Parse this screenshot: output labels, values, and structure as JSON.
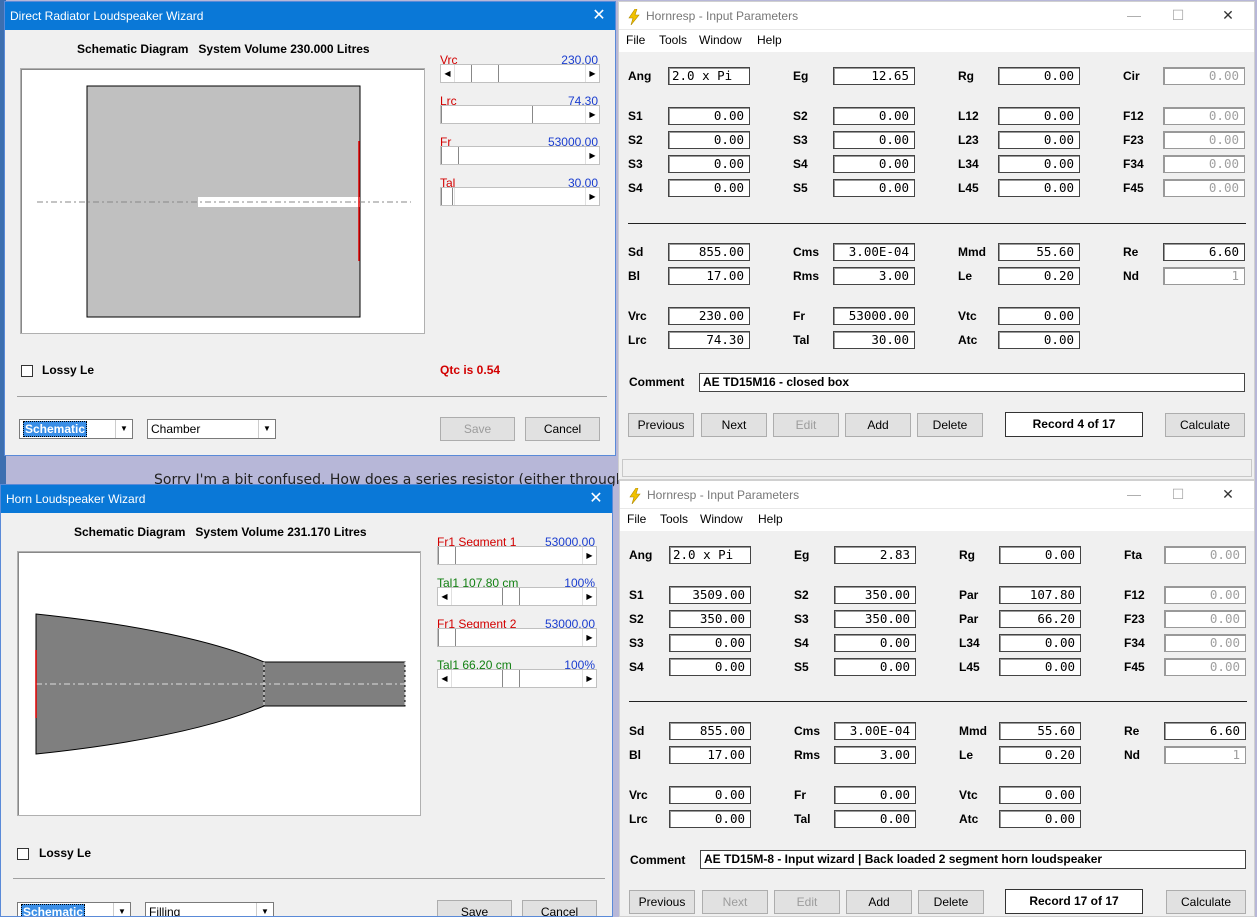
{
  "background_post_text": "Sorry I'm a bit confused. How does a series resistor (either through an inductor or actual resistor) create/control the bass extension?",
  "direct_wizard": {
    "title": "Direct Radiator Loudspeaker Wizard",
    "header_label": "Schematic Diagram",
    "header_volume": "System Volume 230.000 Litres",
    "sliders": [
      {
        "name": "Vrc",
        "value": "230.00"
      },
      {
        "name": "Lrc",
        "value": "74.30"
      },
      {
        "name": "Fr",
        "value": "53000.00"
      },
      {
        "name": "Tal",
        "value": "30.00"
      }
    ],
    "lossy_le": "Lossy Le",
    "qtc": "Qtc is 0.54",
    "view_select": "Schematic",
    "mode_select": "Chamber",
    "save": "Save",
    "cancel": "Cancel"
  },
  "horn_wizard": {
    "title": "Horn Loudspeaker Wizard",
    "header_label": "Schematic Diagram",
    "header_volume": "System Volume 231.170 Litres",
    "sliders": [
      {
        "name": "Fr1  Segment 1",
        "value": "53000.00"
      },
      {
        "name": "Tal1  107.80 cm",
        "value": "100%"
      },
      {
        "name": "Fr1  Segment 2",
        "value": "53000.00"
      },
      {
        "name": "Tal1  66.20 cm",
        "value": "100%"
      }
    ],
    "lossy_le": "Lossy Le",
    "view_select": "Schematic",
    "mode_select": "Filling",
    "save": "Save",
    "cancel": "Cancel"
  },
  "hornresp_top": {
    "title": "Hornresp - Input Parameters",
    "menu": [
      "File",
      "Tools",
      "Window",
      "Help"
    ],
    "rows": [
      [
        {
          "l": "Ang",
          "v": "2.0 x Pi",
          "left": true
        },
        {
          "l": "Eg",
          "v": "12.65"
        },
        {
          "l": "Rg",
          "v": "0.00"
        },
        {
          "l": "Cir",
          "v": "0.00",
          "dis": true
        }
      ],
      [
        {
          "l": "S1",
          "v": "0.00"
        },
        {
          "l": "S2",
          "v": "0.00"
        },
        {
          "l": "L12",
          "v": "0.00"
        },
        {
          "l": "F12",
          "v": "0.00",
          "dis": true
        }
      ],
      [
        {
          "l": "S2",
          "v": "0.00"
        },
        {
          "l": "S3",
          "v": "0.00"
        },
        {
          "l": "L23",
          "v": "0.00"
        },
        {
          "l": "F23",
          "v": "0.00",
          "dis": true
        }
      ],
      [
        {
          "l": "S3",
          "v": "0.00"
        },
        {
          "l": "S4",
          "v": "0.00"
        },
        {
          "l": "L34",
          "v": "0.00"
        },
        {
          "l": "F34",
          "v": "0.00",
          "dis": true
        }
      ],
      [
        {
          "l": "S4",
          "v": "0.00"
        },
        {
          "l": "S5",
          "v": "0.00"
        },
        {
          "l": "L45",
          "v": "0.00"
        },
        {
          "l": "F45",
          "v": "0.00",
          "dis": true
        }
      ],
      [
        {
          "l": "Sd",
          "v": "855.00"
        },
        {
          "l": "Cms",
          "v": "3.00E-04"
        },
        {
          "l": "Mmd",
          "v": "55.60"
        },
        {
          "l": "Re",
          "v": "6.60"
        }
      ],
      [
        {
          "l": "Bl",
          "v": "17.00"
        },
        {
          "l": "Rms",
          "v": "3.00"
        },
        {
          "l": "Le",
          "v": "0.20"
        },
        {
          "l": "Nd",
          "v": "1",
          "dis": true
        }
      ],
      [
        {
          "l": "Vrc",
          "v": "230.00"
        },
        {
          "l": "Fr",
          "v": "53000.00"
        },
        {
          "l": "Vtc",
          "v": "0.00"
        }
      ],
      [
        {
          "l": "Lrc",
          "v": "74.30"
        },
        {
          "l": "Tal",
          "v": "30.00"
        },
        {
          "l": "Atc",
          "v": "0.00"
        }
      ]
    ],
    "comment_label": "Comment",
    "comment": "AE TD15M16 - closed box",
    "buttons": [
      "Previous",
      "Next",
      "Edit",
      "Add",
      "Delete"
    ],
    "record": "Record 4 of 17",
    "calculate": "Calculate"
  },
  "hornresp_bottom": {
    "title": "Hornresp - Input Parameters",
    "menu": [
      "File",
      "Tools",
      "Window",
      "Help"
    ],
    "rows": [
      [
        {
          "l": "Ang",
          "v": "2.0 x Pi",
          "left": true
        },
        {
          "l": "Eg",
          "v": "2.83"
        },
        {
          "l": "Rg",
          "v": "0.00"
        },
        {
          "l": "Fta",
          "v": "0.00",
          "dis": true
        }
      ],
      [
        {
          "l": "S1",
          "v": "3509.00"
        },
        {
          "l": "S2",
          "v": "350.00"
        },
        {
          "l": "Par",
          "v": "107.80"
        },
        {
          "l": "F12",
          "v": "0.00",
          "dis": true
        }
      ],
      [
        {
          "l": "S2",
          "v": "350.00"
        },
        {
          "l": "S3",
          "v": "350.00"
        },
        {
          "l": "Par",
          "v": "66.20"
        },
        {
          "l": "F23",
          "v": "0.00",
          "dis": true
        }
      ],
      [
        {
          "l": "S3",
          "v": "0.00"
        },
        {
          "l": "S4",
          "v": "0.00"
        },
        {
          "l": "L34",
          "v": "0.00"
        },
        {
          "l": "F34",
          "v": "0.00",
          "dis": true
        }
      ],
      [
        {
          "l": "S4",
          "v": "0.00"
        },
        {
          "l": "S5",
          "v": "0.00"
        },
        {
          "l": "L45",
          "v": "0.00"
        },
        {
          "l": "F45",
          "v": "0.00",
          "dis": true
        }
      ],
      [
        {
          "l": "Sd",
          "v": "855.00"
        },
        {
          "l": "Cms",
          "v": "3.00E-04"
        },
        {
          "l": "Mmd",
          "v": "55.60"
        },
        {
          "l": "Re",
          "v": "6.60"
        }
      ],
      [
        {
          "l": "Bl",
          "v": "17.00"
        },
        {
          "l": "Rms",
          "v": "3.00"
        },
        {
          "l": "Le",
          "v": "0.20"
        },
        {
          "l": "Nd",
          "v": "1",
          "dis": true
        }
      ],
      [
        {
          "l": "Vrc",
          "v": "0.00"
        },
        {
          "l": "Fr",
          "v": "0.00"
        },
        {
          "l": "Vtc",
          "v": "0.00"
        }
      ],
      [
        {
          "l": "Lrc",
          "v": "0.00"
        },
        {
          "l": "Tal",
          "v": "0.00"
        },
        {
          "l": "Atc",
          "v": "0.00"
        }
      ]
    ],
    "comment_label": "Comment",
    "comment": "AE TD15M-8 - Input wizard | Back loaded 2 segment horn loudspeaker",
    "buttons": [
      "Previous",
      "Next",
      "Edit",
      "Add",
      "Delete"
    ],
    "record": "Record 17 of 17",
    "calculate": "Calculate"
  },
  "colors": {
    "titlebar": "#0a78d7",
    "accent_red": "#d20000",
    "accent_blue": "#1a3dcf",
    "accent_green": "#128012"
  }
}
